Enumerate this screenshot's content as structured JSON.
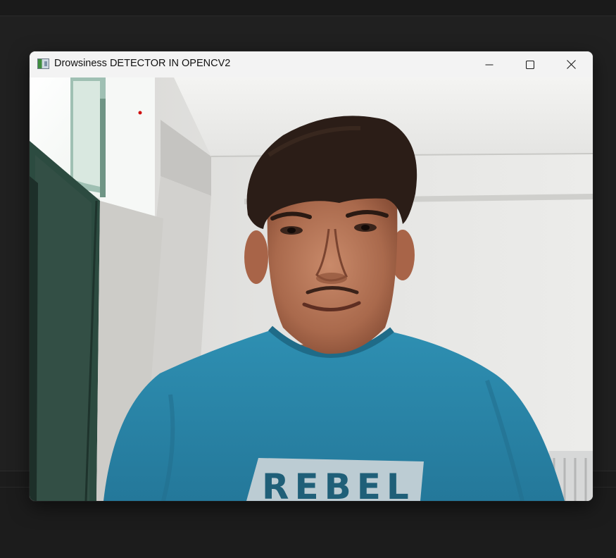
{
  "window": {
    "title": "Drowsiness DETECTOR IN OPENCV2",
    "app_icon": "opencv-window-icon",
    "controls": {
      "minimize_icon": "minimize-icon",
      "maximize_icon": "maximize-icon",
      "close_icon": "close-icon"
    }
  },
  "camera_feed": {
    "shirt_text": "REBEL",
    "colors": {
      "shirt": "#2b87a8",
      "wall": "#e6e6e4",
      "door": "#2f4a40",
      "hair": "#2a1c16",
      "skin": "#b97a5c",
      "marker": "#d01010"
    }
  }
}
